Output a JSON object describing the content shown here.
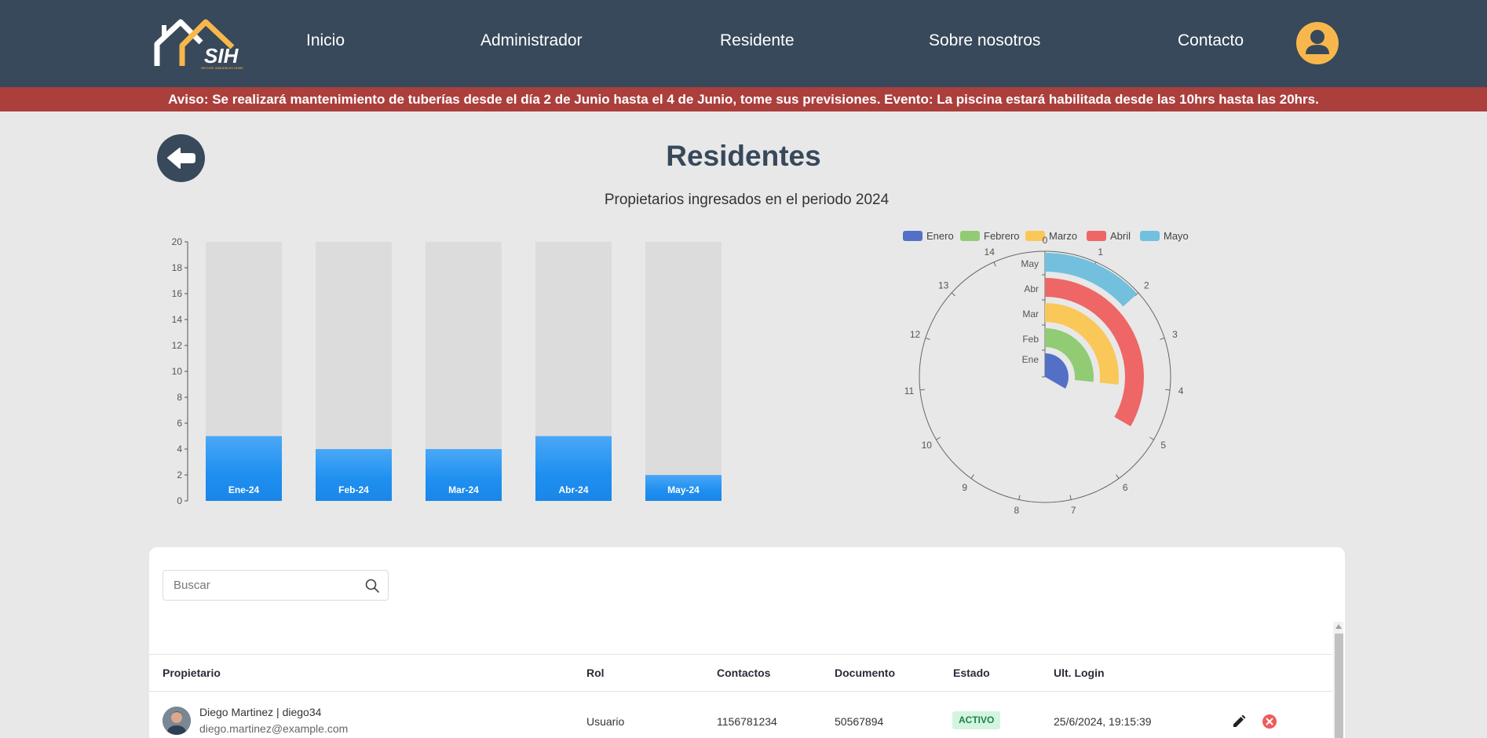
{
  "nav": {
    "logo_text": "SIH",
    "logo_tagline": "SECURE INMUEBLES HOME",
    "links": [
      "Inicio",
      "Administrador",
      "Residente",
      "Sobre nosotros",
      "Contacto"
    ],
    "avatar_icon": "user-icon",
    "accent": "#f8b74c",
    "background": "#37495a"
  },
  "notice": {
    "text": "Aviso: Se realizará mantenimiento de tuberías desde el día 2 de Junio hasta el 4 de Junio, tome sus previsiones. Evento: La piscina estará habilitada desde las 10hrs hasta las 20hrs.",
    "background": "#ab3f3c"
  },
  "page": {
    "back_icon": "arrow-left-icon",
    "title": "Residentes",
    "subtitle": "Propietarios ingresados en el periodo 2024"
  },
  "chart_data": [
    {
      "type": "bar",
      "categories": [
        "Ene-24",
        "Feb-24",
        "Mar-24",
        "Abr-24",
        "May-24"
      ],
      "values": [
        5,
        4,
        4,
        5,
        2
      ],
      "background_max": 20,
      "ylim": [
        0,
        20
      ],
      "yticks": [
        0,
        2,
        4,
        6,
        8,
        10,
        12,
        14,
        16,
        18,
        20
      ],
      "title": "",
      "xlabel": "",
      "ylabel": "",
      "bar_color": "#1e8ff0",
      "track_color": "#dcdcdc",
      "grid": false
    },
    {
      "type": "polar-bar",
      "categories": [
        "Ene",
        "Feb",
        "Mar",
        "Abr",
        "May"
      ],
      "legend": [
        "Enero",
        "Febrero",
        "Marzo",
        "Abril",
        "Mayo"
      ],
      "legend_position": "top",
      "values": [
        5,
        4,
        4,
        5,
        2
      ],
      "angle_axis_max": 15,
      "angle_ticks": [
        0,
        1,
        2,
        3,
        4,
        5,
        6,
        7,
        8,
        9,
        10,
        11,
        12,
        13,
        14
      ],
      "colors": [
        "#5470c6",
        "#91cc75",
        "#fac858",
        "#ee6666",
        "#73c0de"
      ]
    }
  ],
  "table": {
    "search_placeholder": "Buscar",
    "search_icon": "search-icon",
    "headers": [
      "Propietario",
      "Rol",
      "Contactos",
      "Documento",
      "Estado",
      "Ult. Login"
    ],
    "rows": [
      {
        "name": "Diego Martinez | diego34",
        "email": "diego.martinez@example.com",
        "role": "Usuario",
        "contact": "1156781234",
        "document": "50567894",
        "status": "ACTIVO",
        "last_login": "25/6/2024, 19:15:39",
        "edit_icon": "pencil-icon",
        "delete_icon": "close-circle-icon"
      }
    ]
  }
}
